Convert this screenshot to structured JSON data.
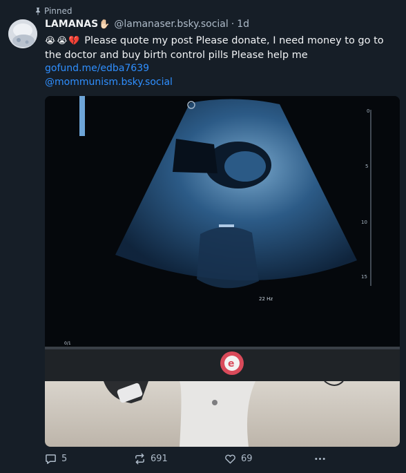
{
  "pinned": {
    "label": "Pinned",
    "icon": "pin-icon"
  },
  "author": {
    "display_name": "LAMANAS",
    "name_emoji": "✋🏻",
    "handle": "@lamanaser.bsky.social",
    "separator": "·",
    "time": "1d",
    "avatar_icon": "avatar-image"
  },
  "post": {
    "emojis": [
      "😭",
      "😭",
      "💔"
    ],
    "text": "Please quote my post Please donate, I need money to go to the doctor and buy birth control pills Please help me",
    "link": "gofund.me/edba7639",
    "mention": "@mommunism.bsky.social"
  },
  "media": {
    "description_icon": "ultrasound-photo",
    "overlay_text": "22 Hz",
    "scale_labels": [
      "0",
      "5",
      "10",
      "15"
    ],
    "frame_label": "0/1"
  },
  "actions": {
    "reply_count": "5",
    "repost_count": "691",
    "like_count": "69",
    "reply_icon": "reply-icon",
    "repost_icon": "repost-icon",
    "like_icon": "heart-icon",
    "more_icon": "more-icon"
  },
  "colors": {
    "background": "#161e27",
    "link": "#2f8fff",
    "muted": "#aebbc9"
  }
}
